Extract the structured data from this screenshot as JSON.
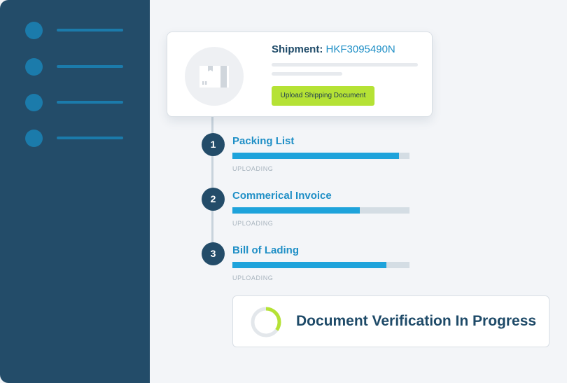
{
  "sidebar": {
    "items": [
      {
        "icon": "nav-dot"
      },
      {
        "icon": "nav-dot"
      },
      {
        "icon": "nav-dot"
      },
      {
        "icon": "nav-dot"
      }
    ]
  },
  "shipment": {
    "label": "Shipment:",
    "id": "HKF3095490N",
    "thumbnail_icon": "box-icon",
    "upload_button_label": "Upload Shipping Document"
  },
  "documents": [
    {
      "number": "1",
      "title": "Packing List",
      "status": "UPLOADING",
      "progress": 0.94
    },
    {
      "number": "2",
      "title": "Commerical Invoice",
      "status": "UPLOADING",
      "progress": 0.72
    },
    {
      "number": "3",
      "title": "Bill of Lading",
      "status": "UPLOADING",
      "progress": 0.87
    }
  ],
  "verification": {
    "text": "Document Verification In Progress",
    "spinner_icon": "progress-ring-icon",
    "progress": 0.35
  },
  "colors": {
    "sidebar": "#234c69",
    "accent": "#1ea3db",
    "button": "#b5e235",
    "dark_text": "#1e4a68"
  }
}
